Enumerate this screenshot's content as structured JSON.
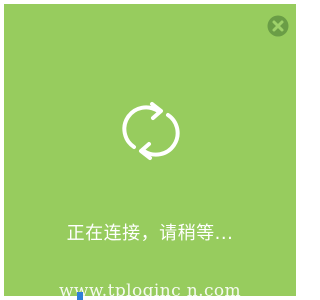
{
  "dialog": {
    "status_text": "正在连接，请稍等...",
    "spinner_icon": "refresh-icon",
    "close_icon": "close-icon",
    "colors": {
      "background": "#97cc5e",
      "foreground": "#ffffff",
      "close_circle": "#6a9d46"
    }
  },
  "watermark": {
    "text": "www.tploginc n.com"
  }
}
